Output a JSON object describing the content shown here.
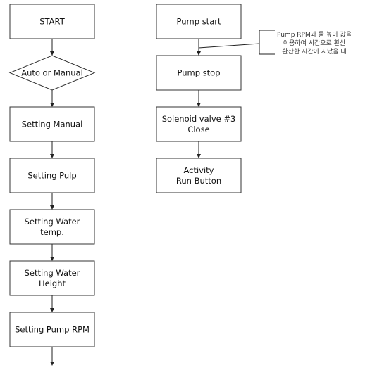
{
  "left_column": [
    {
      "shape": "rect",
      "lines": [
        "START"
      ]
    },
    {
      "shape": "diamond",
      "lines": [
        "Auto or Manual"
      ]
    },
    {
      "shape": "rect",
      "lines": [
        "Setting Manual"
      ]
    },
    {
      "shape": "rect",
      "lines": [
        "Setting Pulp"
      ]
    },
    {
      "shape": "rect",
      "lines": [
        "Setting Water",
        "temp."
      ]
    },
    {
      "shape": "rect",
      "lines": [
        "Setting Water",
        "Height"
      ]
    },
    {
      "shape": "rect",
      "lines": [
        "Setting Pump RPM"
      ]
    }
  ],
  "right_column": [
    {
      "shape": "rect",
      "lines": [
        "Pump start"
      ]
    },
    {
      "shape": "rect",
      "lines": [
        "Pump stop"
      ]
    },
    {
      "shape": "rect",
      "lines": [
        "Solenoid valve #3",
        "Close"
      ]
    },
    {
      "shape": "rect",
      "lines": [
        "Activity",
        "Run Button"
      ]
    }
  ],
  "annotation": {
    "lines": [
      "Pump RPM과 물 높이 값을",
      "이용하여 시간으로 환산",
      "환산한 시간이 지났을 때"
    ]
  }
}
